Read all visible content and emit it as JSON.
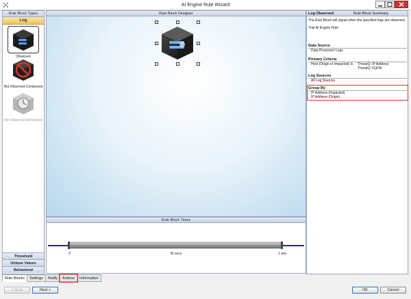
{
  "window": {
    "title": "AI Engine Rule Wizard"
  },
  "left": {
    "header": "Rule Block Types",
    "active_tab": "Log",
    "items": [
      {
        "label": "Observed",
        "selected": true,
        "disabled": false
      },
      {
        "label": "Not Observed Compound",
        "selected": false,
        "disabled": false
      },
      {
        "label": "Not Observed Scheduled",
        "selected": false,
        "disabled": true
      }
    ],
    "stack": [
      "Threshold",
      "Unique Values",
      "Behavioral"
    ]
  },
  "designer": {
    "title": "Rule Block Designer"
  },
  "times": {
    "title": "Rule Block Times",
    "ticks": [
      "0",
      "30 secs",
      "1 min"
    ]
  },
  "summary": {
    "title": "Rule Block Summary",
    "log_observed": {
      "title": "Log Observed",
      "desc": "The Rule Block will signal when the specified logs are observed.",
      "name": "Trial AI Engine Rule"
    },
    "data_source": {
      "title": "Data Source",
      "value": "Data Processor Logs"
    },
    "primary": {
      "title": "Primary Criteria",
      "left": "Host (Origin or Impacted) Is",
      "right1": "ThreatQ: IP Address",
      "right2": "ThreatQ: FQDN"
    },
    "log_sources": {
      "title": "Log Sources",
      "value": "All Log Sources"
    },
    "group_by": {
      "title": "Group By",
      "items": [
        "IP Address (Impacted)",
        "IP Address (Origin)"
      ]
    }
  },
  "tabs": [
    "Rule Blocks",
    "Settings",
    "Notify",
    "Actions",
    "Information"
  ],
  "buttons": {
    "back": "< Back",
    "next": "Next >",
    "ok": "OK",
    "cancel": "Cancel"
  },
  "colors": {
    "highlight": "#d9342b",
    "accent": "#f3c25a",
    "timeline": "#1f2d7a"
  }
}
